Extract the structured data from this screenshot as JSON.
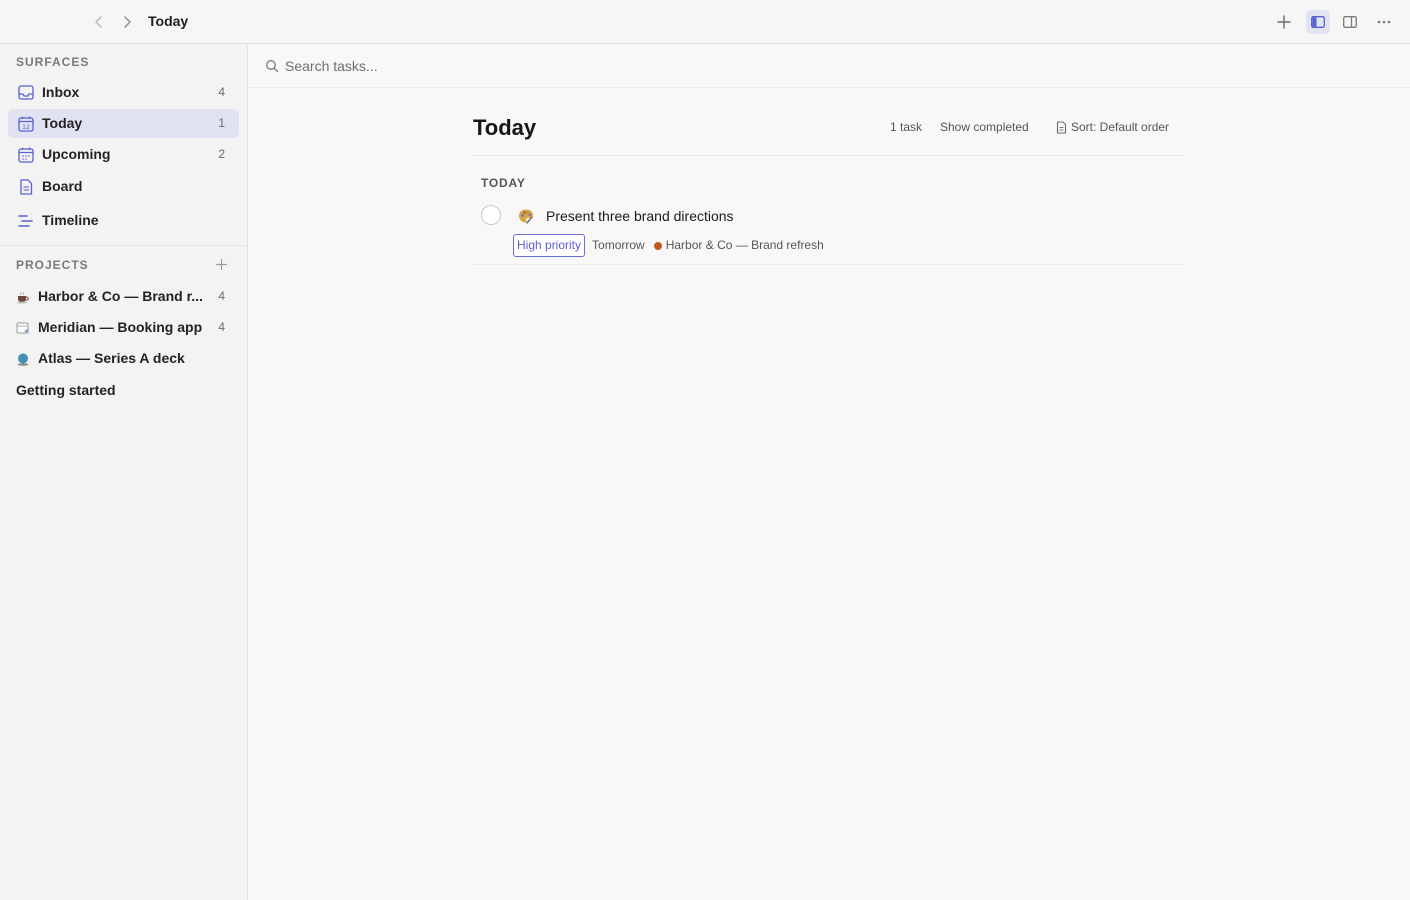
{
  "colors": {
    "accent": "#5a61d1",
    "active_bg": "#e0e2f2",
    "project_dot": "#c2571f"
  },
  "titlebar": {
    "title": "Today",
    "icons": [
      "chevron-left-icon",
      "chevron-right-icon",
      "plus-icon",
      "left-sidebar-icon",
      "right-sidebar-icon",
      "more-icon"
    ]
  },
  "sidebar": {
    "surfaces_header": "SURFACES",
    "surfaces": [
      {
        "label": "Inbox",
        "count": "4",
        "icon": "inbox-icon"
      },
      {
        "label": "Today",
        "count": "1",
        "icon": "calendar-today-icon",
        "active": true
      },
      {
        "label": "Upcoming",
        "count": "2",
        "icon": "calendar-icon"
      },
      {
        "label": "Board",
        "count": "",
        "icon": "document-icon"
      },
      {
        "label": "Timeline",
        "count": "",
        "icon": "timeline-icon"
      }
    ],
    "projects_header": "PROJECTS",
    "projects": [
      {
        "label": "Harbor & Co — Brand r...",
        "count": "4",
        "icon": "coffee-icon"
      },
      {
        "label": "Meridian — Booking app",
        "count": "4",
        "icon": "calendar-app-icon"
      },
      {
        "label": "Atlas — Series A deck",
        "count": "",
        "icon": "globe-icon"
      }
    ],
    "getting_started": "Getting started"
  },
  "search": {
    "placeholder": "Search tasks..."
  },
  "main": {
    "title": "Today",
    "task_count": "1 task",
    "show_completed": "Show completed",
    "sort_label": "Sort: Default order",
    "group_header": "TODAY",
    "tasks": [
      {
        "title": "Present three brand directions",
        "emoji": "palette-icon",
        "priority": "High priority",
        "due": "Tomorrow",
        "project": "Harbor & Co — Brand refresh"
      }
    ]
  }
}
